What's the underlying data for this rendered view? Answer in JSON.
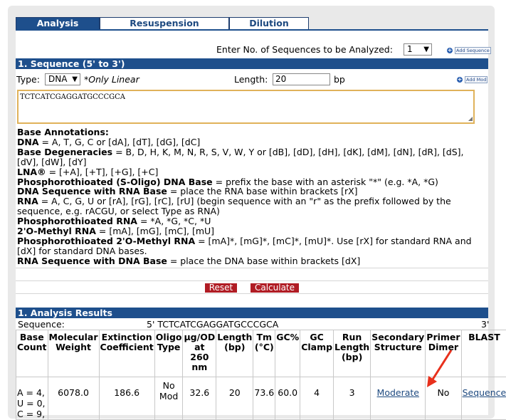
{
  "tabs": [
    "Analysis",
    "Resuspension",
    "Dilution"
  ],
  "num_sequences": {
    "label": "Enter No. of Sequences to be Analyzed:",
    "value": "1",
    "add_label": "Add Sequence"
  },
  "sequence_section": {
    "title": "1. Sequence (5' to 3')",
    "type_label": "Type:",
    "type_value": "DNA",
    "type_note": "*Only Linear",
    "length_label": "Length:",
    "length_value": "20",
    "length_unit": "bp",
    "add_mod_label": "Add Mod",
    "sequence_value": "TCTCATCGAGGATGCCCGCA"
  },
  "annotations": {
    "title": "Base Annotations:",
    "items": [
      {
        "bold": "DNA",
        "text": " = A, T, G, C or [dA], [dT], [dG], [dC]"
      },
      {
        "bold": "Base Degeneracies",
        "text": " = B, D, H, K, M, N, R, S, V, W, Y or [dB], [dD], [dH], [dK], [dM], [dN], [dR], [dS], [dV], [dW], [dY]"
      },
      {
        "bold": "LNA®",
        "text": " = [+A], [+T], [+G], [+C]"
      },
      {
        "bold": "Phosphorothioated (S-Oligo) DNA Base",
        "text": " = prefix the base with an asterisk \"*\" (e.g. *A, *G)"
      },
      {
        "bold": "DNA Sequence with RNA Base",
        "text": " = place the RNA base within brackets [rX]"
      },
      {
        "bold": "RNA",
        "text": " = A, C, G, U or [rA], [rG], [rC], [rU] (begin sequence with an \"r\" as the prefix followed by the sequence, e.g. rACGU, or select Type as RNA)"
      },
      {
        "bold": "Phosphorothioated RNA",
        "text": " = *A, *G, *C, *U"
      },
      {
        "bold": "2'O-Methyl RNA",
        "text": " = [mA], [mG], [mC], [mU]"
      },
      {
        "bold": "Phosphorothioated 2'O-Methyl RNA",
        "text": " = [mA]*, [mG]*, [mC]*, [mU]*. Use [rX] for standard RNA and [dX] for standard DNA bases."
      },
      {
        "bold": "RNA Sequence with DNA Base",
        "text": " = place the DNA base within brackets [dX]"
      }
    ]
  },
  "buttons": {
    "reset": "Reset",
    "calculate": "Calculate"
  },
  "results": {
    "title": "1. Analysis Results",
    "sequence_label": "Sequence:",
    "sequence_5prime": "5' TCTCATCGAGGATGCCCGCA",
    "sequence_3prime": "3'",
    "headers": [
      "Base Count",
      "Molecular Weight",
      "Extinction Coefficient",
      "Oligo Type",
      "μg/OD at 260 nm",
      "Length (bp)",
      "Tm (°C)",
      "GC%",
      "GC Clamp",
      "Run Length (bp)",
      "Secondary Structure",
      "Primer Dimer",
      "BLAST"
    ],
    "row": {
      "base_count": "A = 4, U = 0, C = 9,",
      "molecular_weight": "6078.0",
      "extinction_coefficient": "186.6",
      "oligo_type": "No Mod",
      "ug_per_od": "32.6",
      "length": "20",
      "tm": "73.6",
      "gc_percent": "60.0",
      "gc_clamp": "4",
      "run_length": "3",
      "secondary_structure": "Moderate",
      "primer_dimer": "No",
      "blast": "Sequence"
    }
  },
  "colors": {
    "header_blue": "#1e4f8c",
    "button_red": "#b01c24",
    "arrow_red": "#e8301c",
    "textarea_border": "#e0b25a"
  }
}
